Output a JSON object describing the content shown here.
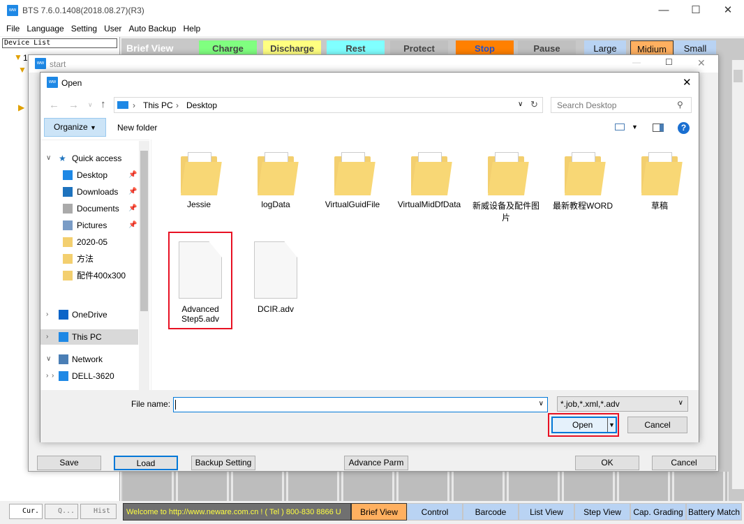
{
  "app": {
    "title": "BTS 7.6.0.1408(2018.08.27)(R3)",
    "logo": "neware-logo-icon",
    "menu": [
      "File",
      "Language",
      "Setting",
      "User",
      "Auto Backup",
      "Help"
    ]
  },
  "device_list": {
    "label": "Device List",
    "node": "1"
  },
  "toolbar": {
    "title": "Brief View",
    "buttons": [
      {
        "label": "Charge",
        "color": "#80ff80"
      },
      {
        "label": "Discharge",
        "color": "#ffff80"
      },
      {
        "label": "Rest",
        "color": "#80ffff"
      },
      {
        "label": "Protect",
        "color": "#c0c0c0"
      },
      {
        "label": "Stop",
        "color": "#ff8000"
      },
      {
        "label": "Pause",
        "color": "#c0c0c0"
      }
    ],
    "sizes": [
      {
        "label": "Large",
        "color": "#b9d3f3"
      },
      {
        "label": "Midium",
        "color": "#ffb060"
      },
      {
        "label": "Small",
        "color": "#b9d3f3"
      }
    ]
  },
  "start_dialog": {
    "title": "start",
    "buttons": [
      "Save",
      "Load",
      "Backup Setting",
      "Advance Parm",
      "OK",
      "Cancel"
    ]
  },
  "open_dialog": {
    "title": "Open",
    "breadcrumb": [
      "This PC",
      "Desktop"
    ],
    "search_placeholder": "Search Desktop",
    "organize": "Organize",
    "new_folder": "New folder",
    "nav": [
      {
        "label": "Quick access",
        "icon": "star-icon"
      },
      {
        "label": "Desktop",
        "icon": "desktop-icon",
        "pinned": true
      },
      {
        "label": "Downloads",
        "icon": "download-icon",
        "pinned": true
      },
      {
        "label": "Documents",
        "icon": "documents-icon",
        "pinned": true
      },
      {
        "label": "Pictures",
        "icon": "pictures-icon",
        "pinned": true
      },
      {
        "label": "2020-05",
        "icon": "folder-icon"
      },
      {
        "label": "方法",
        "icon": "folder-icon"
      },
      {
        "label": "配件400x300",
        "icon": "folder-icon"
      },
      {
        "label": "OneDrive",
        "icon": "cloud-icon"
      },
      {
        "label": "This PC",
        "icon": "computer-icon",
        "selected": true
      },
      {
        "label": "Network",
        "icon": "network-icon"
      },
      {
        "label": "DELL-3620",
        "icon": "computer-icon"
      }
    ],
    "folders": [
      "Jessie",
      "logData",
      "VirtualGuidFile",
      "VirtualMidDfData",
      "新威设备及配件图片",
      "最新教程WORD",
      "草稿"
    ],
    "files": [
      {
        "name": "Advanced Step5.adv",
        "highlighted": true
      },
      {
        "name": "DCIR.adv"
      }
    ],
    "file_name_label": "File name:",
    "file_name_value": "",
    "filter": "*.job,*.xml,*.adv",
    "open": "Open",
    "cancel": "Cancel"
  },
  "status": {
    "welcome": "Welcome to http://www.neware.com.cn !   ( Tel ) 800-830 8866  U",
    "tabs": [
      {
        "label": "Brief View",
        "active": true
      },
      {
        "label": "Control"
      },
      {
        "label": "Barcode"
      },
      {
        "label": "List View"
      },
      {
        "label": "Step View"
      },
      {
        "label": "Cap. Grading"
      },
      {
        "label": "Battery Match"
      }
    ],
    "left_tabs": [
      "Cur.",
      "Q...",
      "Hist"
    ]
  },
  "highlight_color": "#e81123"
}
